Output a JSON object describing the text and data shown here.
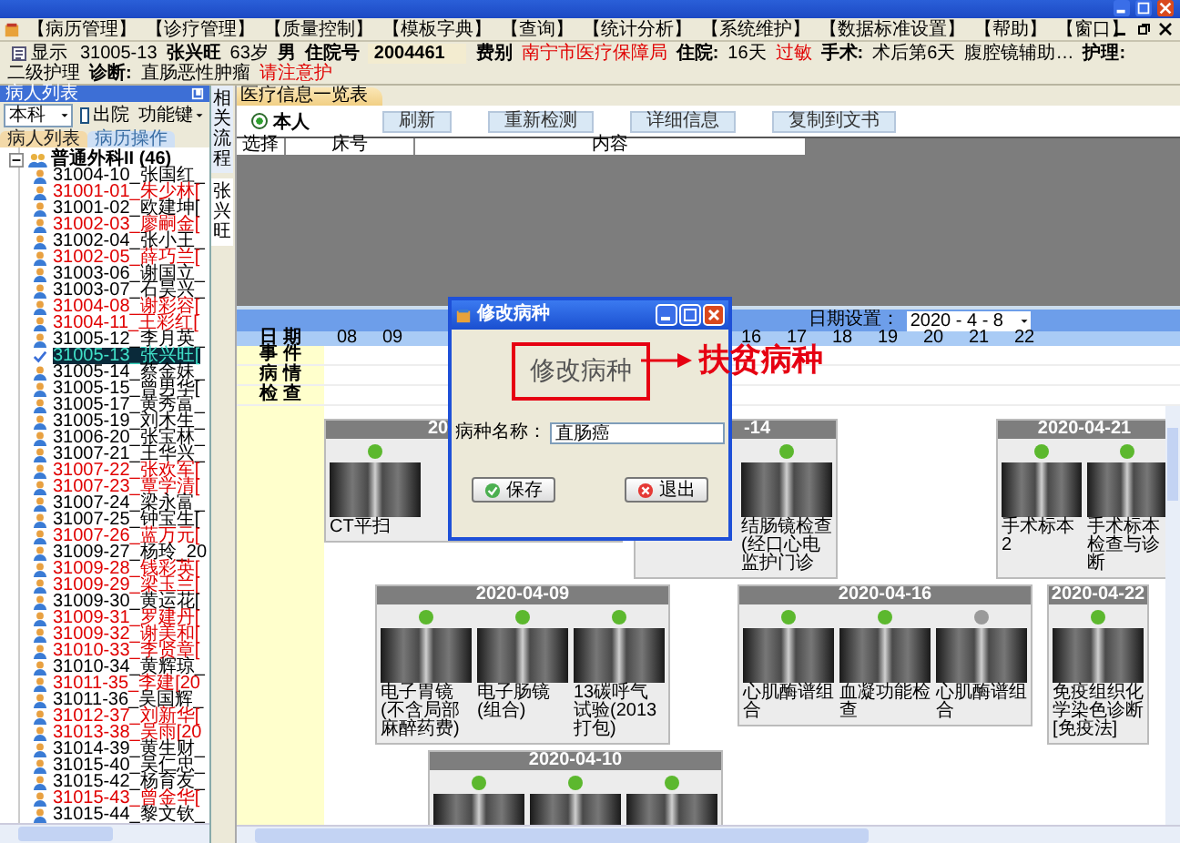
{
  "menu": {
    "items": [
      "【病历管理】",
      "【诊疗管理】",
      "【质量控制】",
      "【模板字典】",
      "【查询】",
      "【统计分析】",
      "【系统维护】",
      "【数据标准设置】",
      "【帮助】",
      "【窗口】"
    ]
  },
  "patient_bar": {
    "show_button": "显示",
    "fields": [
      {
        "text": "31005-13",
        "kind": "value"
      },
      {
        "text": "张兴旺",
        "kind": "strong"
      },
      {
        "text": "63岁",
        "kind": "value"
      },
      {
        "text": "男",
        "kind": "strong"
      },
      {
        "text": "住院号",
        "kind": "strong"
      },
      {
        "text": "2004461",
        "kind": "box"
      },
      {
        "text": "费别",
        "kind": "strong"
      },
      {
        "text": "南宁市医疗保障局",
        "kind": "alert"
      },
      {
        "text": "住院:",
        "kind": "strong"
      },
      {
        "text": "16天",
        "kind": "value"
      },
      {
        "text": "过敏",
        "kind": "alert"
      },
      {
        "text": "手术:",
        "kind": "strong"
      },
      {
        "text": "术后第6天",
        "kind": "value"
      },
      {
        "text": "腹腔镜辅助…",
        "kind": "value"
      },
      {
        "text": "护理:",
        "kind": "strong"
      },
      {
        "text": "二级护理",
        "kind": "value"
      },
      {
        "text": "诊断:",
        "kind": "strong"
      },
      {
        "text": "直肠恶性肿瘤",
        "kind": "value"
      },
      {
        "text": "请注意护",
        "kind": "alert"
      }
    ]
  },
  "patient_panel": {
    "title": "病人列表",
    "dept": "本科",
    "discharged": {
      "label": "出院",
      "checked": false
    },
    "function_key": "功能键",
    "tabs": [
      {
        "label": "病人列表",
        "selected": true
      },
      {
        "label": "病历操作",
        "selected": false
      }
    ],
    "tree": {
      "label": "普通外科II (46)",
      "expanded": true,
      "children": [
        {
          "label": "31004-10_张国红_",
          "alert": false,
          "selected": false
        },
        {
          "label": "31001-01_朱少林[",
          "alert": true,
          "selected": false
        },
        {
          "label": "31001-02_欧建坤[",
          "alert": false,
          "selected": false
        },
        {
          "label": "31002-03_廖嗣金[",
          "alert": true,
          "selected": false
        },
        {
          "label": "31002-04_张小王_",
          "alert": false,
          "selected": false
        },
        {
          "label": "31002-05_薛巧兰[",
          "alert": true,
          "selected": false
        },
        {
          "label": "31003-06_谢国立_",
          "alert": false,
          "selected": false
        },
        {
          "label": "31003-07_石昊兴_",
          "alert": false,
          "selected": false
        },
        {
          "label": "31004-08_谢彩容[",
          "alert": true,
          "selected": false
        },
        {
          "label": "31004-11_王彩红[",
          "alert": true,
          "selected": false
        },
        {
          "label": "31005-12_李月英_",
          "alert": false,
          "selected": false
        },
        {
          "label": "31005-13_张兴旺[",
          "alert": false,
          "selected": true
        },
        {
          "label": "31005-14_蔡金妹_",
          "alert": false,
          "selected": false
        },
        {
          "label": "31005-15_曾男华[",
          "alert": false,
          "selected": false
        },
        {
          "label": "31005-17_黄秀富_",
          "alert": false,
          "selected": false
        },
        {
          "label": "31005-19_刘木生_",
          "alert": false,
          "selected": false
        },
        {
          "label": "31006-20_张宝林_",
          "alert": false,
          "selected": false
        },
        {
          "label": "31007-21_王华兴_",
          "alert": false,
          "selected": false
        },
        {
          "label": "31007-22_张欢军[",
          "alert": true,
          "selected": false
        },
        {
          "label": "31007-23_覃学清[",
          "alert": true,
          "selected": false
        },
        {
          "label": "31007-24_梁永富_",
          "alert": false,
          "selected": false
        },
        {
          "label": "31007-25_钟宝生[",
          "alert": false,
          "selected": false
        },
        {
          "label": "31007-26_蓝万元[",
          "alert": true,
          "selected": false
        },
        {
          "label": "31009-27_杨玲_20",
          "alert": false,
          "selected": false
        },
        {
          "label": "31009-28_钱彩英[",
          "alert": true,
          "selected": false
        },
        {
          "label": "31009-29_梁玉兰[",
          "alert": true,
          "selected": false
        },
        {
          "label": "31009-30_黄运花[",
          "alert": false,
          "selected": false
        },
        {
          "label": "31009-31_罗建丹[",
          "alert": true,
          "selected": false
        },
        {
          "label": "31009-32_谢美和[",
          "alert": true,
          "selected": false
        },
        {
          "label": "31010-33_李贤章[",
          "alert": true,
          "selected": false
        },
        {
          "label": "31010-34_黄辉琼_",
          "alert": false,
          "selected": false
        },
        {
          "label": "31011-35_李建[20",
          "alert": true,
          "selected": false
        },
        {
          "label": "31011-36_吴国辉_",
          "alert": false,
          "selected": false
        },
        {
          "label": "31012-37_刘新华[",
          "alert": true,
          "selected": false
        },
        {
          "label": "31013-38_吴雨[20",
          "alert": true,
          "selected": false
        },
        {
          "label": "31014-39_黄生财_",
          "alert": false,
          "selected": false
        },
        {
          "label": "31015-40_吴仁忠_",
          "alert": false,
          "selected": false
        },
        {
          "label": "31015-42_杨育友_",
          "alert": false,
          "selected": false
        },
        {
          "label": "31015-43_曾金华[",
          "alert": true,
          "selected": false
        },
        {
          "label": "31015-44_黎文钦_",
          "alert": false,
          "selected": false
        }
      ]
    }
  },
  "side_tabs": [
    {
      "label": "相关流程",
      "selected": false
    },
    {
      "label": "张兴旺",
      "selected": true
    }
  ],
  "main": {
    "tab": "医疗信息一览表",
    "radio": {
      "label": "本人",
      "selected": true
    },
    "buttons": [
      "刷新",
      "重新检测",
      "详细信息",
      "复制到文书"
    ],
    "columns": [
      "选择",
      "床号",
      "内容"
    ]
  },
  "timeline": {
    "date_setting_label": "日期设置：",
    "date_value": "2020 - 4 - 8",
    "date_label": "日 期",
    "days_before": [
      "08",
      "09"
    ],
    "days_after": [
      "16",
      "17",
      "18",
      "19",
      "20",
      "21",
      "22"
    ],
    "rows": [
      "事 件",
      "病 情",
      "检 查"
    ],
    "cards": [
      {
        "date": "20",
        "covered_right": true,
        "items": [
          {
            "color": "#5cb82e",
            "caption": "CT平扫"
          }
        ]
      },
      {
        "date": "-14",
        "covered_left": true,
        "items": [
          {
            "color": "#5cb82e",
            "caption": "结肠镜检查(经口心电监护门诊"
          }
        ]
      },
      {
        "date": "2020-04-21",
        "items": [
          {
            "color": "#5cb82e",
            "caption": "手术标本2"
          },
          {
            "color": "#5cb82e",
            "caption": "手术标本检查与诊断"
          }
        ]
      },
      {
        "date": "2020-04-09",
        "items": [
          {
            "color": "#5cb82e",
            "caption": "电子胃镜(不含局部麻醉药费)"
          },
          {
            "color": "#5cb82e",
            "caption": "电子肠镜(组合)"
          },
          {
            "color": "#5cb82e",
            "caption": "13碳呼气试验(2013打包)"
          }
        ]
      },
      {
        "date": "2020-04-16",
        "items": [
          {
            "color": "#5cb82e",
            "caption": "心肌酶谱组合"
          },
          {
            "color": "#5cb82e",
            "caption": "血凝功能检查"
          },
          {
            "color": "#9a9a9a",
            "caption": "心肌酶谱组合"
          }
        ]
      },
      {
        "date": "2020-04-22",
        "items": [
          {
            "color": "#5cb82e",
            "caption": "免疫组织化学染色诊断[免疫法]"
          }
        ]
      },
      {
        "date": "2020-04-10",
        "items": [
          {
            "color": "#5cb82e"
          },
          {
            "color": "#5cb82e"
          },
          {
            "color": "#5cb82e"
          }
        ]
      }
    ]
  },
  "dialog": {
    "title": "修改病种",
    "heading": "修改病种",
    "field_label": "病种名称：",
    "field_value": "直肠癌",
    "buttons": [
      {
        "label": "保存",
        "kind": "save"
      },
      {
        "label": "退出",
        "kind": "exit"
      }
    ]
  },
  "annotation": {
    "text": "扶贫病种"
  }
}
